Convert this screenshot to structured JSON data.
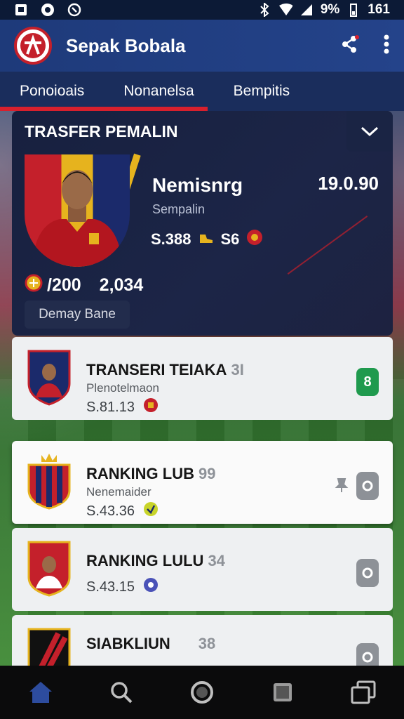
{
  "status_bar": {
    "battery": "9%",
    "time": "161"
  },
  "app": {
    "title": "Sepak Bobala"
  },
  "tabs": [
    {
      "label": "Ponoioais"
    },
    {
      "label": "Nonanelsa"
    },
    {
      "label": "Bempitis"
    }
  ],
  "feature": {
    "title": "TRASFER PEMALIN",
    "player_name": "Nemisnrg",
    "fee": "19.0.90",
    "role": "Sempalin",
    "stat_a": "S.388",
    "stat_b": "S6",
    "big_a": "/200",
    "big_b": "2,034",
    "button_label": "Demay Bane",
    "colors": {
      "accent": "#d8202d",
      "gold": "#e6b31e"
    }
  },
  "cards": [
    {
      "title": "TRANSERI TEIAKA",
      "num": "3I",
      "sub": "Plenotelmaon",
      "meta": "S.81.13",
      "badge": "8",
      "badge_color": "green",
      "crest_bg": "#1b2a6b",
      "crest_accent": "#c4202b"
    },
    {
      "title": "RANKING LUB",
      "num": "99",
      "sub": "Nenemaider",
      "meta": "S.43.36",
      "badge": "",
      "badge_color": "gray",
      "crest_bg": "#c4202b",
      "crest_accent": "#1b2a6b"
    },
    {
      "title": "RANKING LULU",
      "num": "34",
      "sub": "",
      "meta": "S.43.15",
      "badge": "",
      "badge_color": "gray",
      "crest_bg": "#c4202b",
      "crest_accent": "#e6b31e"
    },
    {
      "title": "SIABKLIUN",
      "num": "38",
      "sub": "",
      "meta": "",
      "badge": "",
      "badge_color": "gray",
      "crest_bg": "#111111",
      "crest_accent": "#c4202b"
    }
  ],
  "bottom_nav": [
    {
      "icon": "home-icon"
    },
    {
      "icon": "search-icon"
    },
    {
      "icon": "circle-icon"
    },
    {
      "icon": "square-icon"
    },
    {
      "icon": "recents-icon"
    }
  ]
}
